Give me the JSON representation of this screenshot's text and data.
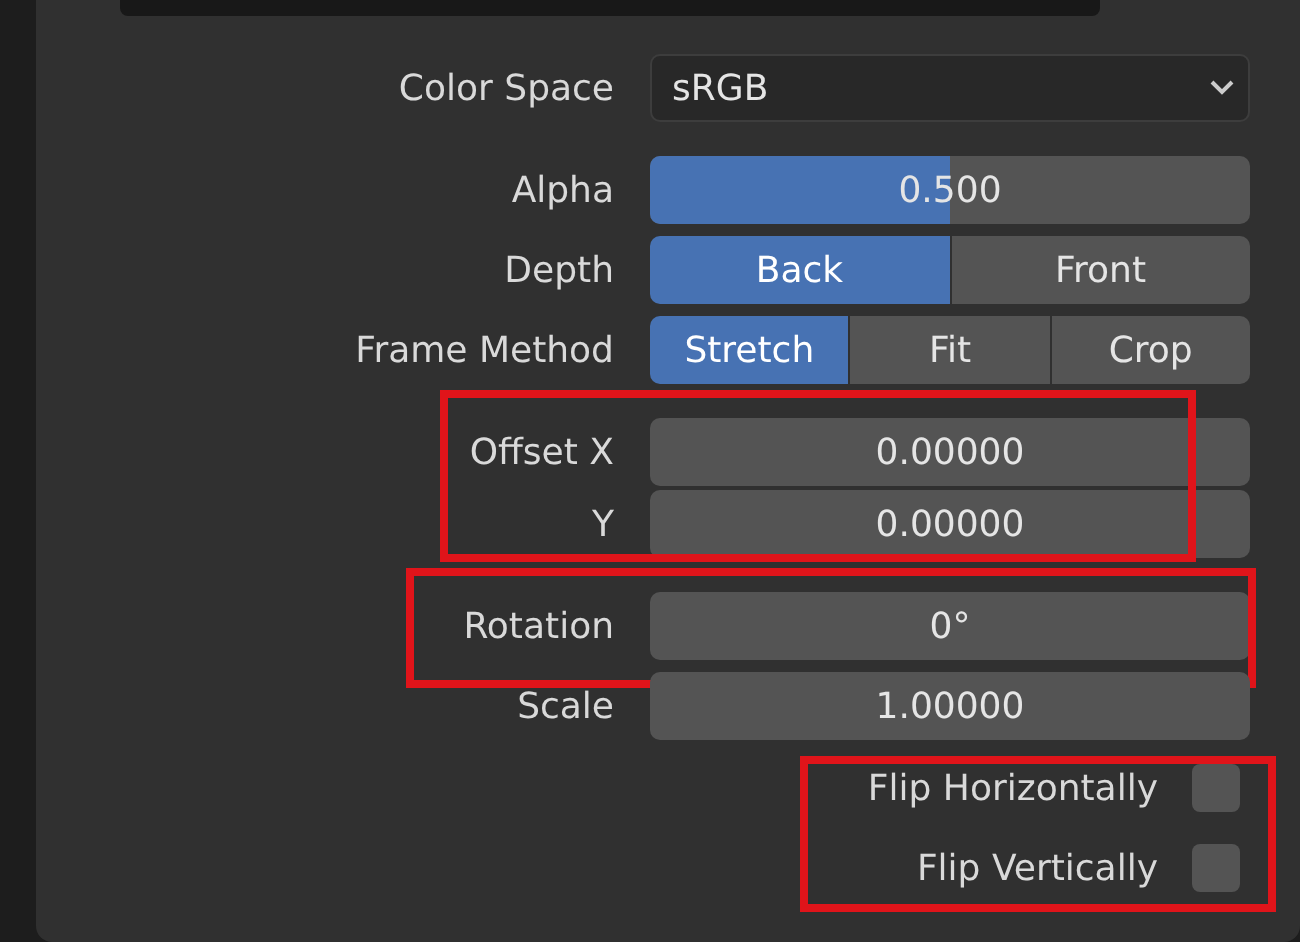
{
  "groups": [
    {
      "highlighted": false,
      "rows": [
        {
          "kind": "dropdown",
          "label": "Color Space",
          "value": "sRGB"
        }
      ]
    },
    {
      "highlighted": false,
      "rows": [
        {
          "kind": "slider",
          "label": "Alpha",
          "value": "0.500",
          "level": 0.5
        },
        {
          "kind": "toggle-group",
          "label": "Depth",
          "options": [
            {
              "label": "Back",
              "selected": true
            },
            {
              "label": "Front",
              "selected": false
            }
          ]
        },
        {
          "kind": "toggle-group",
          "label": "Frame Method",
          "options": [
            {
              "label": "Stretch",
              "selected": true
            },
            {
              "label": "Fit",
              "selected": false
            },
            {
              "label": "Crop",
              "selected": false
            }
          ]
        }
      ]
    },
    {
      "highlighted": true,
      "rows": [
        {
          "kind": "number",
          "label": "Offset X",
          "value": "0.00000"
        },
        {
          "kind": "number",
          "label": "Y",
          "value": "0.00000"
        }
      ]
    },
    {
      "highlighted": true,
      "rows": [
        {
          "kind": "number",
          "label": "Rotation",
          "value": "0°"
        }
      ]
    },
    {
      "highlighted": false,
      "rows": [
        {
          "kind": "number",
          "label": "Scale",
          "value": "1.00000"
        }
      ]
    },
    {
      "highlighted": true,
      "rows": [
        {
          "kind": "checkbox",
          "label": "Flip Horizontally",
          "checked": false
        },
        {
          "kind": "checkbox",
          "label": "Flip Vertically",
          "checked": false
        }
      ]
    }
  ]
}
